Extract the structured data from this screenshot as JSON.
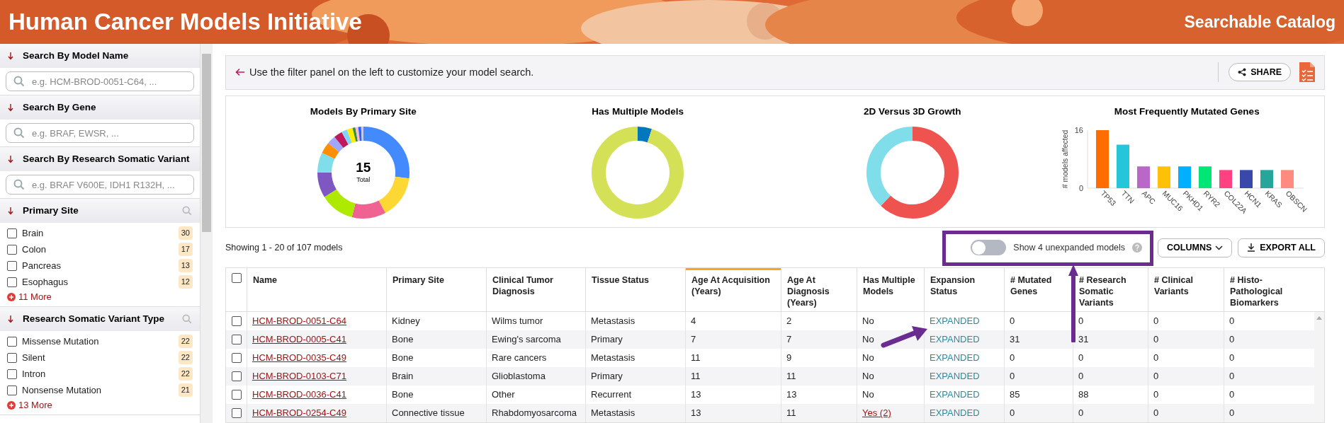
{
  "header": {
    "title": "Human Cancer Models Initiative",
    "subtitle": "Searchable Catalog"
  },
  "sidebar": {
    "sections": [
      {
        "kind": "search",
        "title": "Search By Model Name",
        "placeholder": "e.g. HCM-BROD-0051-C64, ..."
      },
      {
        "kind": "search",
        "title": "Search By Gene",
        "placeholder": "e.g. BRAF, EWSR, ..."
      },
      {
        "kind": "search",
        "title": "Search By Research Somatic Variant",
        "placeholder": "e.g. BRAF V600E, IDH1 R132H, ..."
      },
      {
        "kind": "facet",
        "title": "Primary Site",
        "more": "11 More",
        "items": [
          {
            "label": "Brain",
            "count": "30",
            "checked": false
          },
          {
            "label": "Colon",
            "count": "17",
            "checked": false
          },
          {
            "label": "Pancreas",
            "count": "13",
            "checked": false
          },
          {
            "label": "Esophagus",
            "count": "12",
            "checked": false
          }
        ]
      },
      {
        "kind": "facet",
        "title": "Research Somatic Variant Type",
        "more": "13 More",
        "items": [
          {
            "label": "Missense Mutation",
            "count": "22",
            "checked": false
          },
          {
            "label": "Silent",
            "count": "22",
            "checked": false
          },
          {
            "label": "Intron",
            "count": "22",
            "checked": false
          },
          {
            "label": "Nonsense Mutation",
            "count": "21",
            "checked": false
          }
        ]
      }
    ]
  },
  "main": {
    "notice": "Use the filter panel on the left to customize your model search.",
    "share_button": "SHARE",
    "charts": [
      {
        "kind": "donut",
        "title": "Models By Primary Site",
        "center_value": "15",
        "center_label": "Total"
      },
      {
        "kind": "donut",
        "title": "Has Multiple Models"
      },
      {
        "kind": "donut",
        "title": "2D Versus 3D Growth"
      },
      {
        "kind": "bar",
        "chart_data": {
          "type": "bar",
          "title": "Most Frequently Mutated Genes",
          "categories": [
            "TP53",
            "TTN",
            "APC",
            "MUC16",
            "PKHD1",
            "RYR2",
            "COL22A",
            "HCN1",
            "KRAS",
            "OBSCN"
          ],
          "series": [
            {
              "name": "# models affected",
              "values": [
                16,
                12,
                6,
                6,
                6,
                6,
                5,
                5,
                5,
                5
              ]
            }
          ],
          "ylim": [
            0,
            16
          ],
          "yticks": [
            0,
            16
          ]
        }
      }
    ],
    "toolbar": {
      "showing": "Showing 1 - 20 of 107 models",
      "toggle": {
        "label": "Show 4 unexpanded models",
        "on": false
      },
      "columns_button": "COLUMNS",
      "export_button": "EXPORT ALL"
    },
    "table": {
      "all_checked": false,
      "columns": [
        {
          "label": "Name",
          "kind": "name",
          "sorted": false
        },
        {
          "label": "Primary Site",
          "kind": "text",
          "sorted": false
        },
        {
          "label": "Clinical Tumor Diagnosis",
          "kind": "text",
          "sorted": false
        },
        {
          "label": "Tissue Status",
          "kind": "text",
          "sorted": false
        },
        {
          "label": "Age At Acquisition (Years)",
          "kind": "text",
          "sorted": true
        },
        {
          "label": "Age At Diagnosis (Years)",
          "kind": "text",
          "sorted": false
        },
        {
          "label": "Has Multiple Models",
          "kind": "multiple",
          "sorted": false
        },
        {
          "label": "Expansion Status",
          "kind": "status",
          "sorted": false
        },
        {
          "label": "# Mutated Genes",
          "kind": "text",
          "sorted": false
        },
        {
          "label": "# Research Somatic Variants",
          "kind": "text",
          "sorted": false
        },
        {
          "label": "# Clinical Variants",
          "kind": "text",
          "sorted": false
        },
        {
          "label": "# Histo-Pathological Biomarkers",
          "kind": "text",
          "sorted": false
        }
      ],
      "rows": [
        {
          "checked": false,
          "has_multiple_models": false,
          "cells": [
            "HCM-BROD-0051-C64",
            "Kidney",
            "Wilms tumor",
            "Metastasis",
            "4",
            "2",
            "No",
            "EXPANDED",
            "0",
            "0",
            "0",
            "0"
          ]
        },
        {
          "checked": false,
          "has_multiple_models": false,
          "cells": [
            "HCM-BROD-0005-C41",
            "Bone",
            "Ewing's sarcoma",
            "Primary",
            "7",
            "7",
            "No",
            "EXPANDED",
            "31",
            "31",
            "0",
            "0"
          ]
        },
        {
          "checked": false,
          "has_multiple_models": false,
          "cells": [
            "HCM-BROD-0035-C49",
            "Bone",
            "Rare cancers",
            "Metastasis",
            "11",
            "9",
            "No",
            "EXPANDED",
            "0",
            "0",
            "0",
            "0"
          ]
        },
        {
          "checked": false,
          "has_multiple_models": false,
          "cells": [
            "HCM-BROD-0103-C71",
            "Brain",
            "Glioblastoma",
            "Primary",
            "11",
            "11",
            "No",
            "EXPANDED",
            "0",
            "0",
            "0",
            "0"
          ]
        },
        {
          "checked": false,
          "has_multiple_models": false,
          "cells": [
            "HCM-BROD-0036-C41",
            "Bone",
            "Other",
            "Recurrent",
            "13",
            "13",
            "No",
            "EXPANDED",
            "85",
            "88",
            "0",
            "0"
          ]
        },
        {
          "checked": false,
          "has_multiple_models": true,
          "cells": [
            "HCM-BROD-0254-C49",
            "Connective tissue",
            "Rhabdomyosarcoma",
            "Metastasis",
            "13",
            "11",
            "Yes (2)",
            "EXPANDED",
            "0",
            "0",
            "0",
            "0"
          ]
        }
      ]
    }
  }
}
